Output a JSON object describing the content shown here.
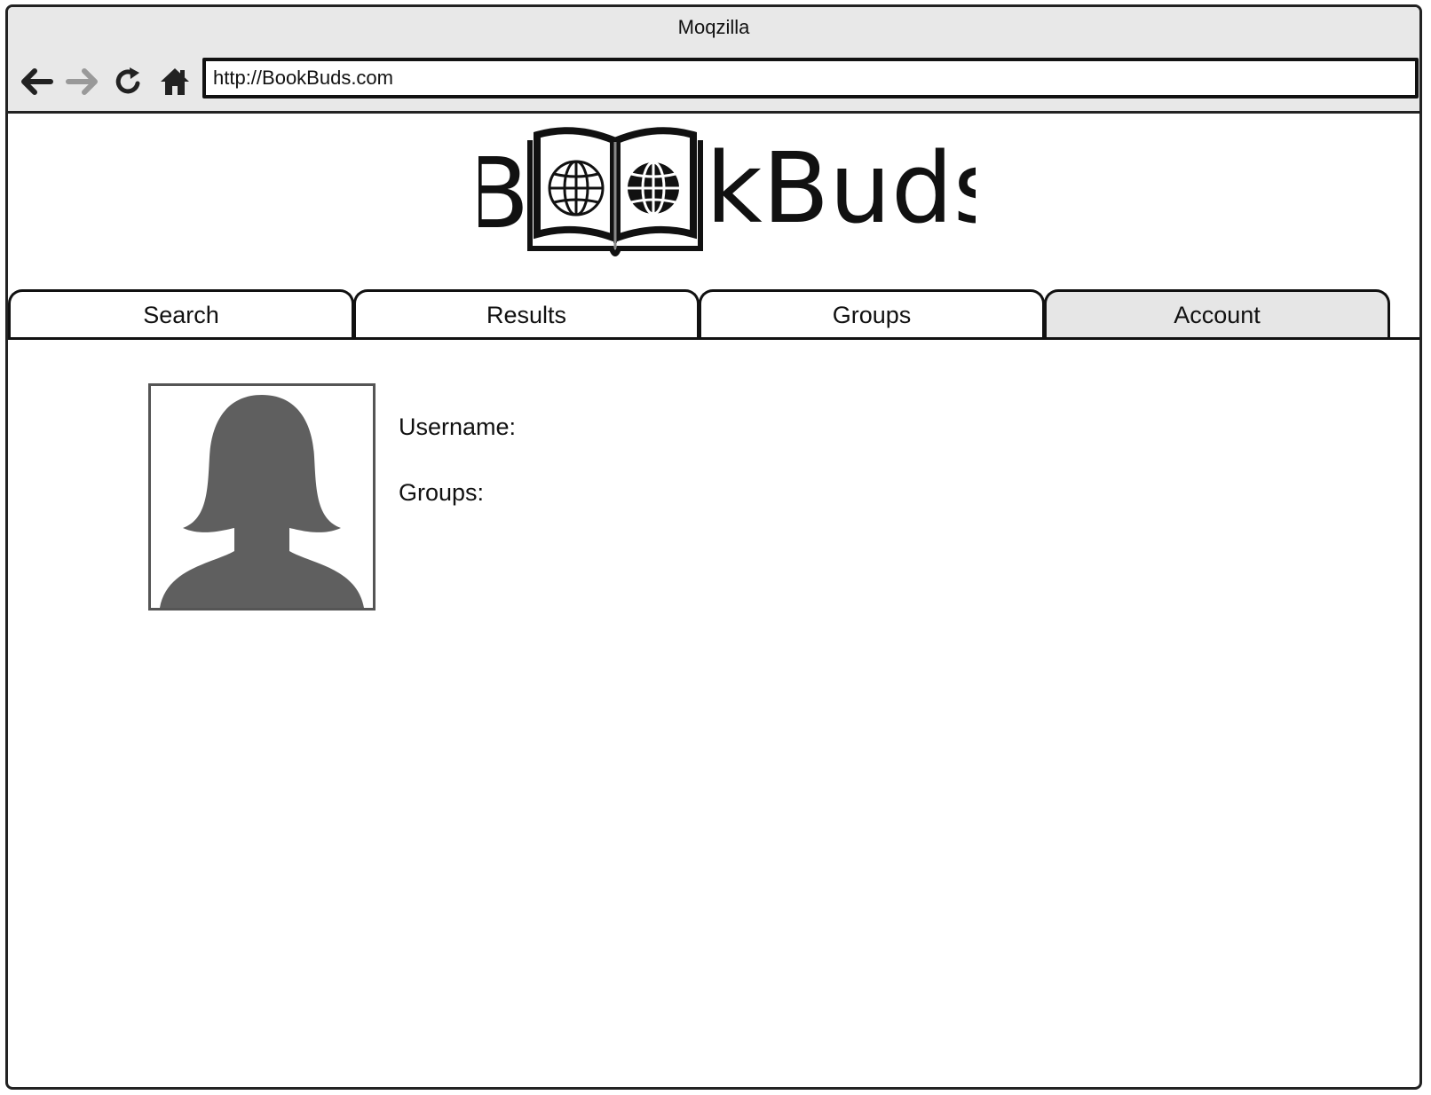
{
  "browser": {
    "title": "Moqzilla",
    "url": "http://BookBuds.com",
    "nav": {
      "back_icon": "arrow-left-icon",
      "forward_icon": "arrow-right-icon",
      "reload_icon": "reload-icon",
      "home_icon": "home-icon"
    }
  },
  "logo": {
    "text_before": "B",
    "text_after": "kBuds",
    "icon": "open-book-globe-icon"
  },
  "tabs": [
    {
      "label": "Search",
      "active": false
    },
    {
      "label": "Results",
      "active": false
    },
    {
      "label": "Groups",
      "active": false
    },
    {
      "label": "Account",
      "active": true
    }
  ],
  "account": {
    "avatar_icon": "user-silhouette-icon",
    "username_label": "Username:",
    "groups_label": "Groups:"
  },
  "colors": {
    "chrome_bg": "#e8e8e8",
    "active_tab_bg": "#e6e6e6",
    "avatar_fill": "#5f5f5f",
    "forward_disabled": "#999999"
  }
}
